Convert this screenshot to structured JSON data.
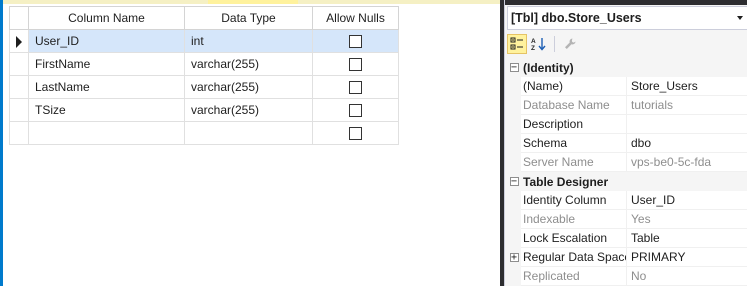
{
  "designer": {
    "columns_header": {
      "column_name": "Column Name",
      "data_type": "Data Type",
      "allow_nulls": "Allow Nulls"
    },
    "rows": [
      {
        "name": "User_ID",
        "type": "int",
        "allow_nulls": false,
        "active": true
      },
      {
        "name": "FirstName",
        "type": "varchar(255)",
        "allow_nulls": false,
        "active": false
      },
      {
        "name": "LastName",
        "type": "varchar(255)",
        "allow_nulls": false,
        "active": false
      },
      {
        "name": "TSize",
        "type": "varchar(255)",
        "allow_nulls": false,
        "active": false
      },
      {
        "name": "",
        "type": "",
        "allow_nulls": false,
        "active": false
      }
    ]
  },
  "properties": {
    "object_label": "[Tbl] dbo.Store_Users",
    "toolbar": {
      "categorized_icon": "categorized-icon",
      "alphabetical_icon": "alphabetical-icon",
      "property_pages_icon": "wrench-icon"
    },
    "categories": [
      {
        "name": "(Identity)",
        "expanded": true,
        "items": [
          {
            "name": "(Name)",
            "value": "Store_Users",
            "readonly": false
          },
          {
            "name": "Database Name",
            "value": "tutorials",
            "readonly": true
          },
          {
            "name": "Description",
            "value": "",
            "readonly": false
          },
          {
            "name": "Schema",
            "value": "dbo",
            "readonly": false
          },
          {
            "name": "Server Name",
            "value": "vps-be0-5c-fda",
            "readonly": true
          }
        ]
      },
      {
        "name": "Table Designer",
        "expanded": true,
        "items": [
          {
            "name": "Identity Column",
            "value": "User_ID",
            "readonly": false
          },
          {
            "name": "Indexable",
            "value": "Yes",
            "readonly": true
          },
          {
            "name": "Lock Escalation",
            "value": "Table",
            "readonly": false
          },
          {
            "name": "Regular Data Space",
            "value": "PRIMARY",
            "readonly": false,
            "expandable": true
          },
          {
            "name": "Replicated",
            "value": "No",
            "readonly": true
          }
        ]
      }
    ]
  },
  "colors": {
    "accent": "#007acc",
    "selection": "#d5e6fa",
    "toolbar_active": "#fff29d"
  }
}
